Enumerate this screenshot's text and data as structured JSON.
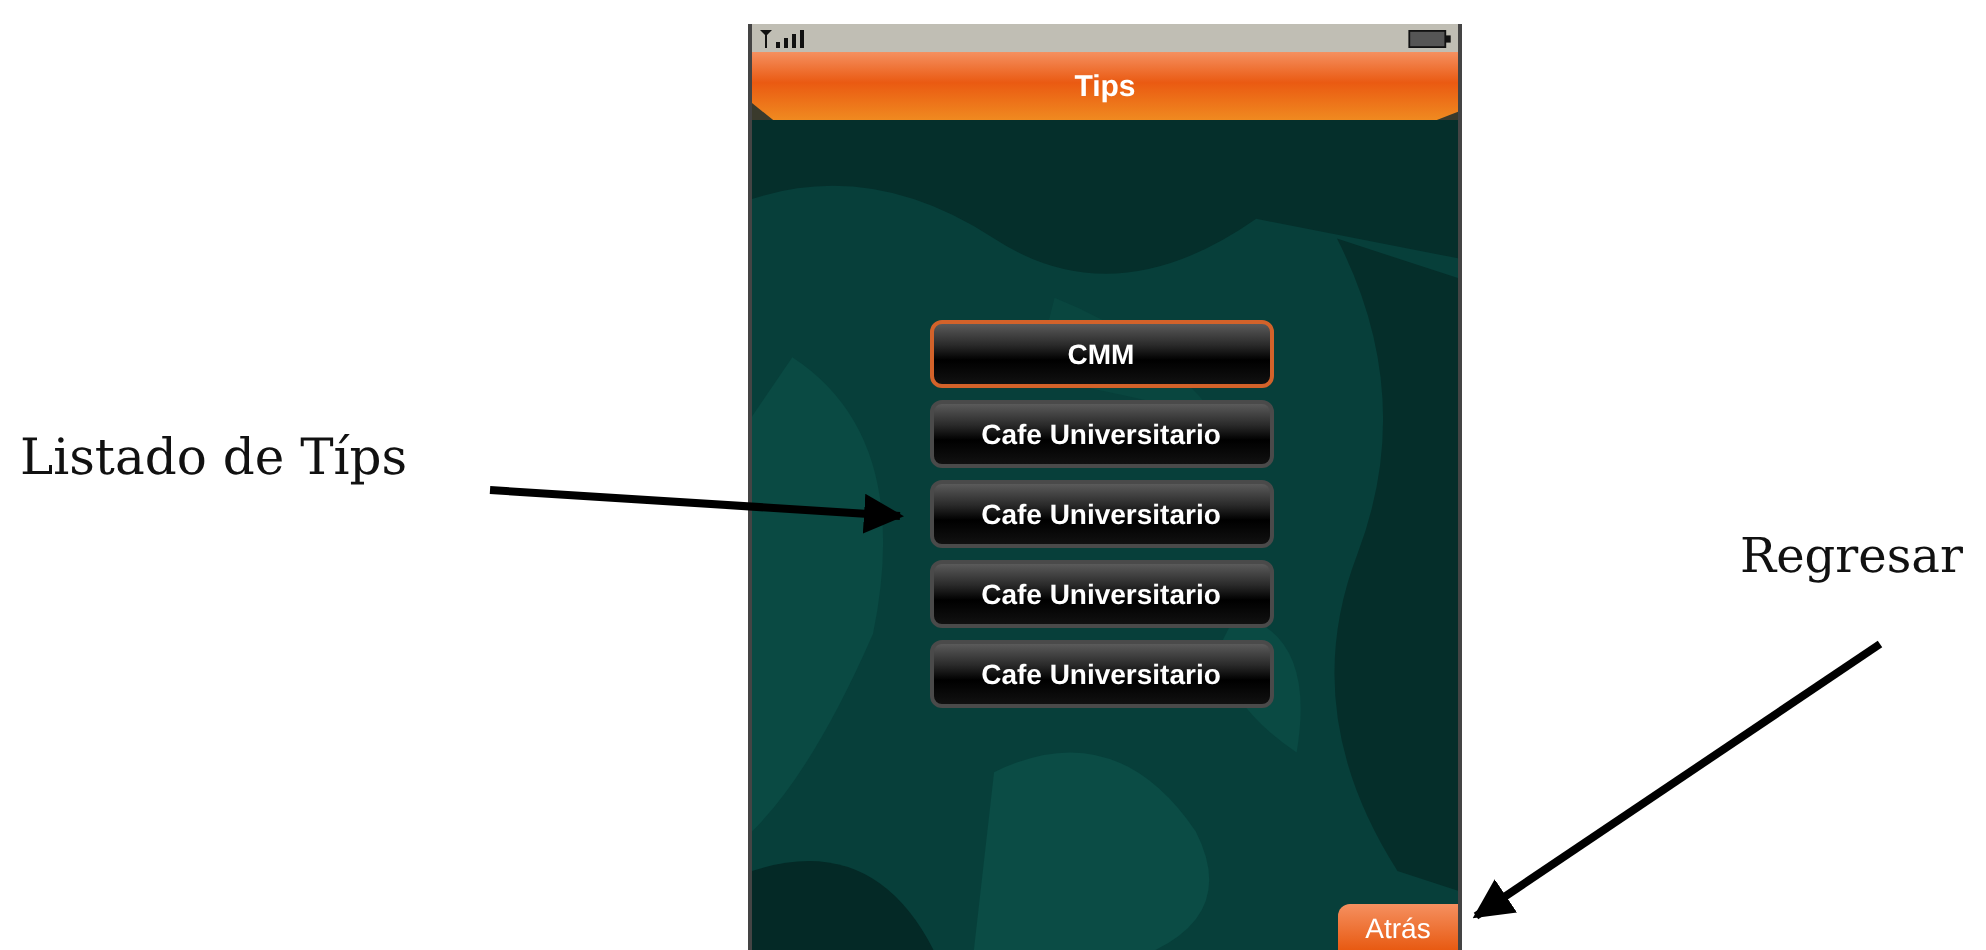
{
  "callouts": {
    "list_label": "Listado de Típs",
    "back_label": "Regresar"
  },
  "phone": {
    "title": "Tips",
    "tips": [
      {
        "label": "CMM",
        "selected": true
      },
      {
        "label": "Cafe Universitario",
        "selected": false
      },
      {
        "label": "Cafe Universitario",
        "selected": false
      },
      {
        "label": "Cafe Universitario",
        "selected": false
      },
      {
        "label": "Cafe Universitario",
        "selected": false
      }
    ],
    "back_button": "Atrás"
  }
}
